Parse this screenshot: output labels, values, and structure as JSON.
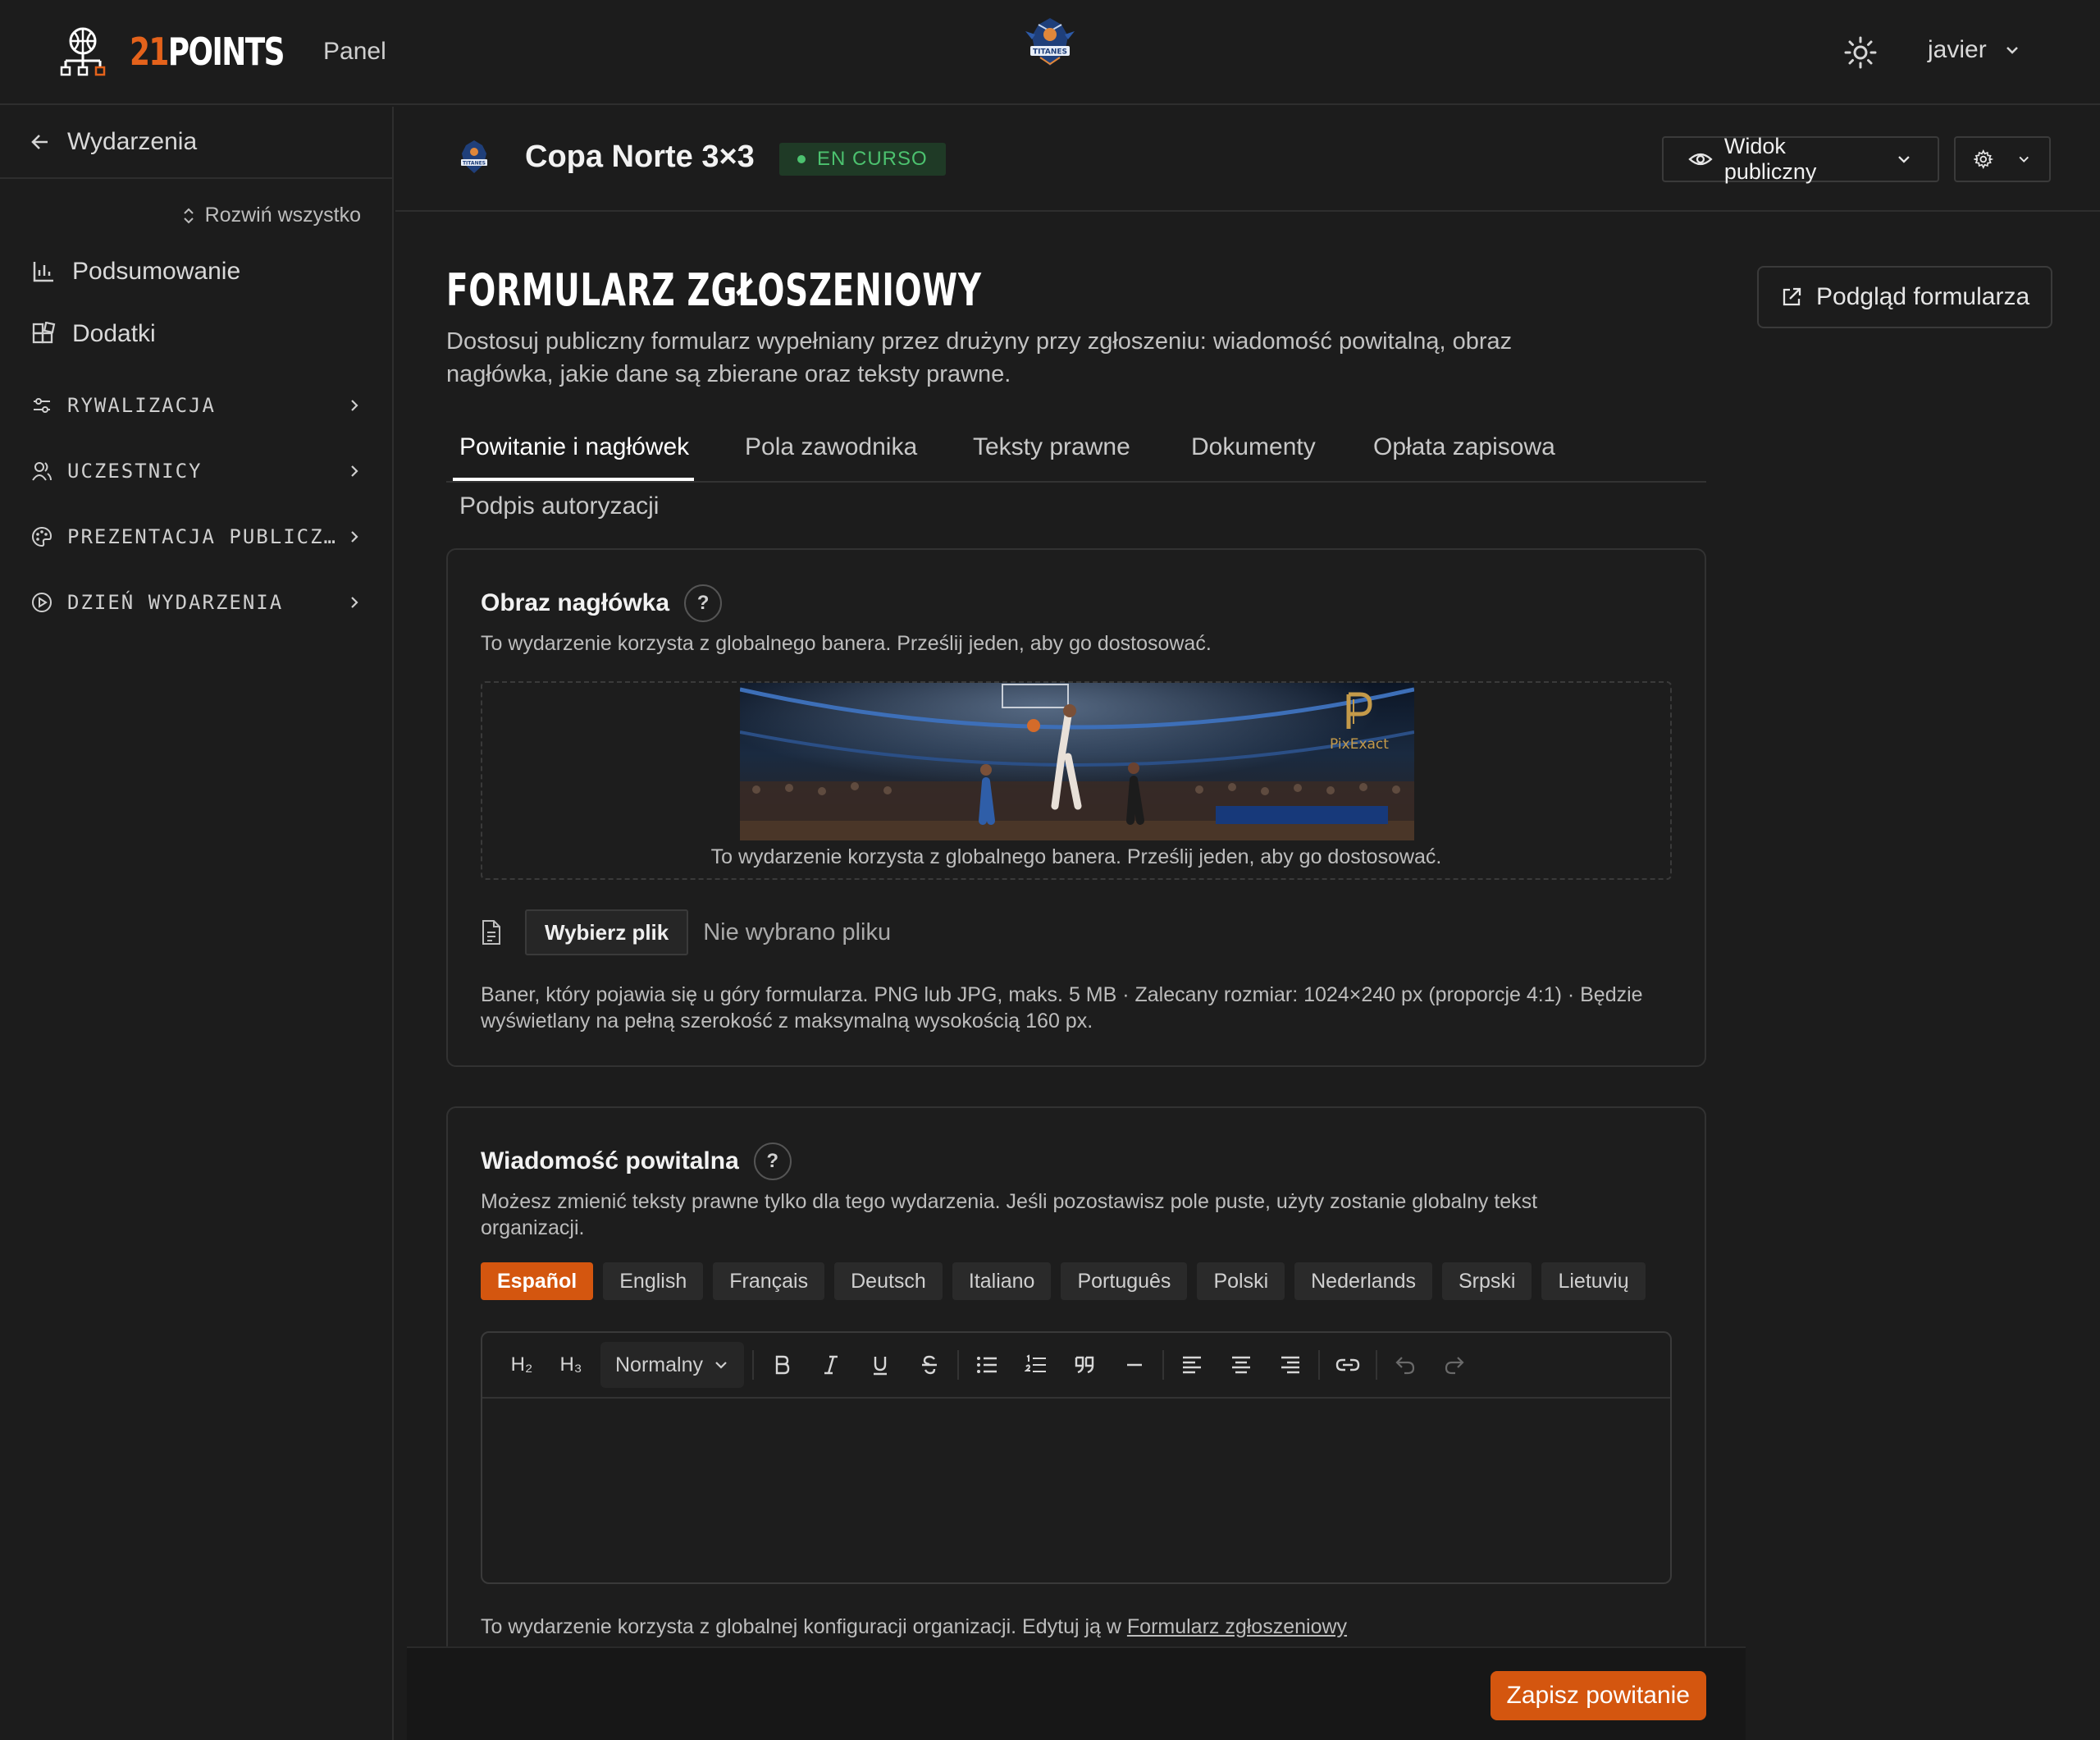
{
  "header": {
    "brand_num": "21",
    "brand_word": "POINTS",
    "nav_panel": "Panel",
    "user_name": "javier"
  },
  "sidebar": {
    "back_label": "Wydarzenia",
    "expand_all": "Rozwiń wszystko",
    "items": [
      {
        "label": "Podsumowanie",
        "icon": "bar-chart-icon"
      },
      {
        "label": "Dodatki",
        "icon": "addons-grid-icon"
      }
    ],
    "sections": [
      {
        "label": "RYWALIZACJA",
        "icon": "sliders-icon"
      },
      {
        "label": "UCZESTNICY",
        "icon": "users-icon"
      },
      {
        "label": "PREZENTACJA PUBLICZ…",
        "icon": "palette-icon"
      },
      {
        "label": "DZIEŃ WYDARZENIA",
        "icon": "play-circle-icon"
      }
    ]
  },
  "event": {
    "title": "Copa Norte 3×3",
    "status": "EN CURSO",
    "public_view": "Widok publiczny"
  },
  "page": {
    "heading": "FORMULARZ ZGŁOSZENIOWY",
    "description": "Dostosuj publiczny formularz wypełniany przez drużyny przy zgłoszeniu: wiadomość powitalną, obraz nagłówka, jakie dane są zbierane oraz teksty prawne.",
    "preview_button": "Podgląd formularza"
  },
  "tabs": [
    {
      "label": "Powitanie i nagłówek",
      "active": true
    },
    {
      "label": "Pola zawodnika"
    },
    {
      "label": "Teksty prawne"
    },
    {
      "label": "Dokumenty"
    },
    {
      "label": "Opłata zapisowa"
    },
    {
      "label": "Podpis autoryzacji"
    }
  ],
  "header_image_card": {
    "title": "Obraz nagłówka",
    "help": "?",
    "subtitle": "To wydarzenie korzysta z globalnego banera. Prześlij jeden, aby go dostosować.",
    "banner_watermark": "PixExact",
    "drop_caption": "To wydarzenie korzysta z globalnego banera. Prześlij jeden, aby go dostosować.",
    "file_button": "Wybierz plik",
    "file_status": "Nie wybrano pliku",
    "hint": "Baner, który pojawia się u góry formularza. PNG lub JPG, maks. 5 MB · Zalecany rozmiar: 1024×240 px (proporcje 4:1) · Będzie wyświetlany na pełną szerokość z maksymalną wysokością 160 px."
  },
  "welcome_card": {
    "title": "Wiadomość powitalna",
    "help": "?",
    "subtitle": "Możesz zmienić teksty prawne tylko dla tego wydarzenia. Jeśli pozostawisz pole puste, użyty zostanie globalny tekst organizacji.",
    "languages": [
      "Español",
      "English",
      "Français",
      "Deutsch",
      "Italiano",
      "Português",
      "Polski",
      "Nederlands",
      "Srpski",
      "Lietuvių"
    ],
    "active_language": "Español",
    "toolbar": {
      "h2": "H₂",
      "h3": "H₃",
      "format": "Normalny"
    },
    "config_note": "To wydarzenie korzysta z globalnej konfiguracji organizacji. Edytuj ją w",
    "config_link": "Formularz zgłoszeniowy"
  },
  "footer": {
    "save_button": "Zapisz powitanie"
  },
  "colors": {
    "accent": "#d4560f",
    "status_green": "#4cc26f",
    "background": "#1c1c1c"
  }
}
